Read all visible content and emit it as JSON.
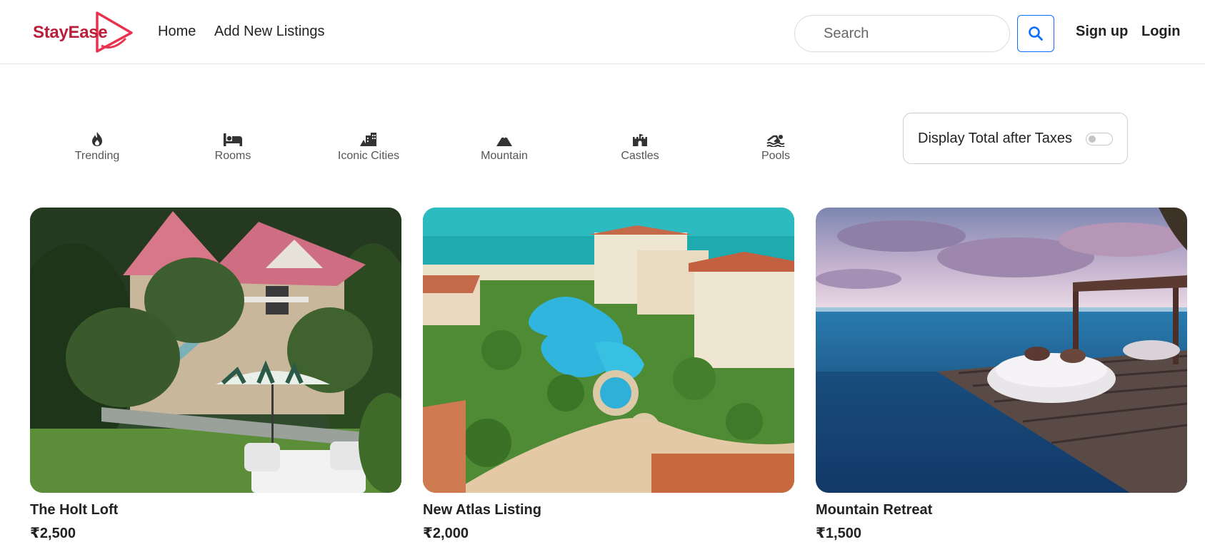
{
  "navbar": {
    "brand": "StayEase",
    "links": [
      "Home",
      "Add New Listings"
    ],
    "search_placeholder": "Search",
    "search_icon": "search-icon",
    "signup": "Sign up",
    "login": "Login"
  },
  "filters": [
    {
      "label": "Trending",
      "icon": "fire-icon"
    },
    {
      "label": "Rooms",
      "icon": "bed-icon"
    },
    {
      "label": "Iconic Cities",
      "icon": "city-icon"
    },
    {
      "label": "Mountain",
      "icon": "mountain-icon"
    },
    {
      "label": "Castles",
      "icon": "castle-icon"
    },
    {
      "label": "Pools",
      "icon": "swimmer-icon"
    }
  ],
  "tax_toggle": {
    "label": "Display Total after Taxes",
    "checked": false
  },
  "listings": [
    {
      "title": "The Holt Loft",
      "price": "₹2,500"
    },
    {
      "title": "New Atlas Listing",
      "price": "₹2,000"
    },
    {
      "title": "Mountain Retreat",
      "price": "₹1,500"
    }
  ],
  "colors": {
    "brand": "#b81f3a",
    "brand_icon": "#e8324e",
    "search_button_border": "#0d6efd",
    "text": "#222222",
    "muted": "#555555"
  }
}
